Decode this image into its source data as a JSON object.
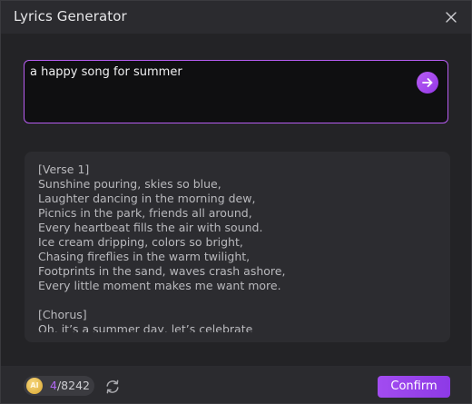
{
  "window": {
    "title": "Lyrics Generator"
  },
  "prompt": {
    "value": "a happy song for summer"
  },
  "lyrics": {
    "text": "[Verse 1]\nSunshine pouring, skies so blue,\nLaughter dancing in the morning dew,\nPicnics in the park, friends all around,\nEvery heartbeat fills the air with sound.\nIce cream dripping, colors so bright,\nChasing fireflies in the warm twilight,\nFootprints in the sand, waves crash ashore,\nEvery little moment makes me want more.\n\n[Chorus]\nOh, it’s a summer day, let’s celebrate"
  },
  "footer": {
    "ai_badge": "AI",
    "credits_used": "4",
    "credits_total": "/8242",
    "confirm_label": "Confirm"
  },
  "icons": {
    "close": "close-icon",
    "send": "arrow-right-icon",
    "refresh": "refresh-icon"
  },
  "colors": {
    "accent": "#a24cf0",
    "accent_light": "#b168f3",
    "coin": "#e0b040"
  }
}
